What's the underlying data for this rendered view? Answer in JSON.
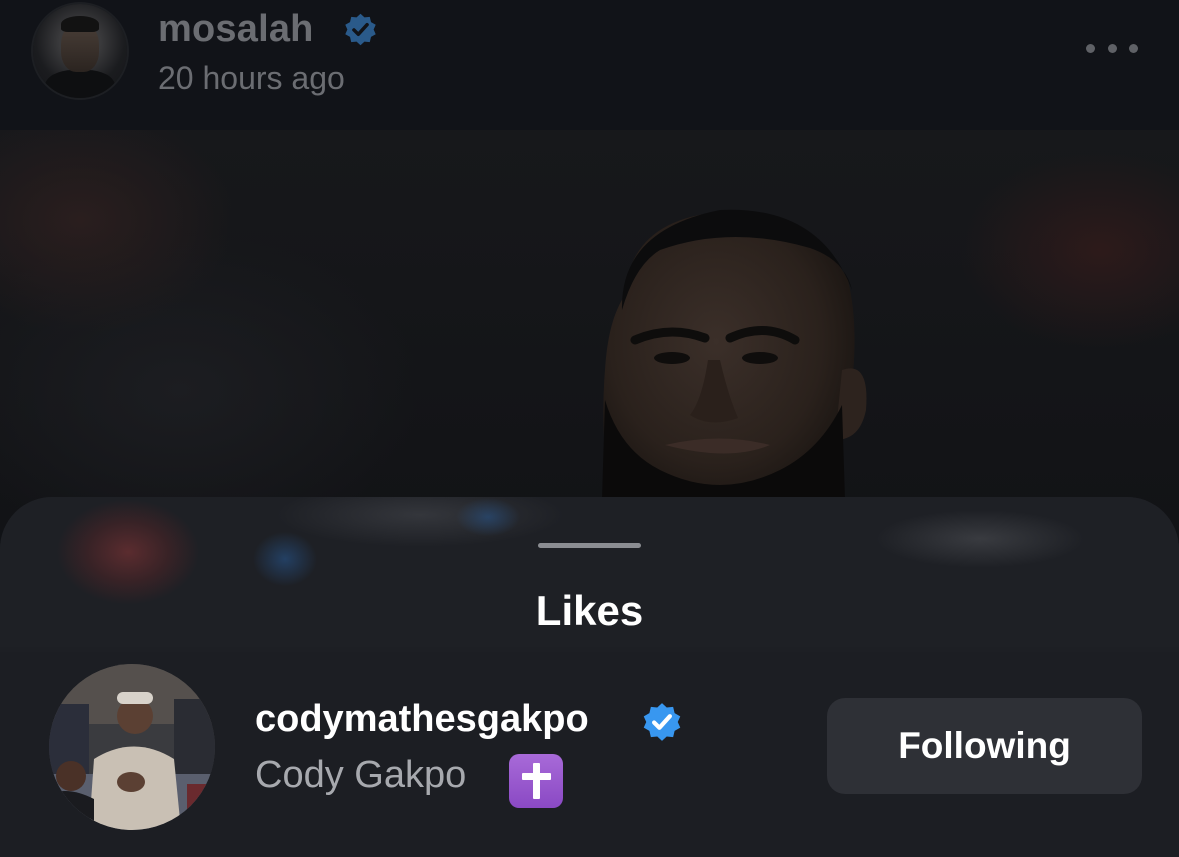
{
  "post": {
    "username": "mosalah",
    "time": "20 hours ago",
    "verified": true,
    "more_icon": "more-horizontal-icon"
  },
  "likes_sheet": {
    "title": "Likes",
    "items": [
      {
        "username": "codymathesgakpo",
        "verified": true,
        "full_name": "Cody Gakpo",
        "emoji": "latin-cross-emoji",
        "button_label": "Following"
      }
    ]
  },
  "colors": {
    "verified_badge": "#3897f0",
    "sheet_background": "#1e2025",
    "button_background": "#2e3036"
  }
}
